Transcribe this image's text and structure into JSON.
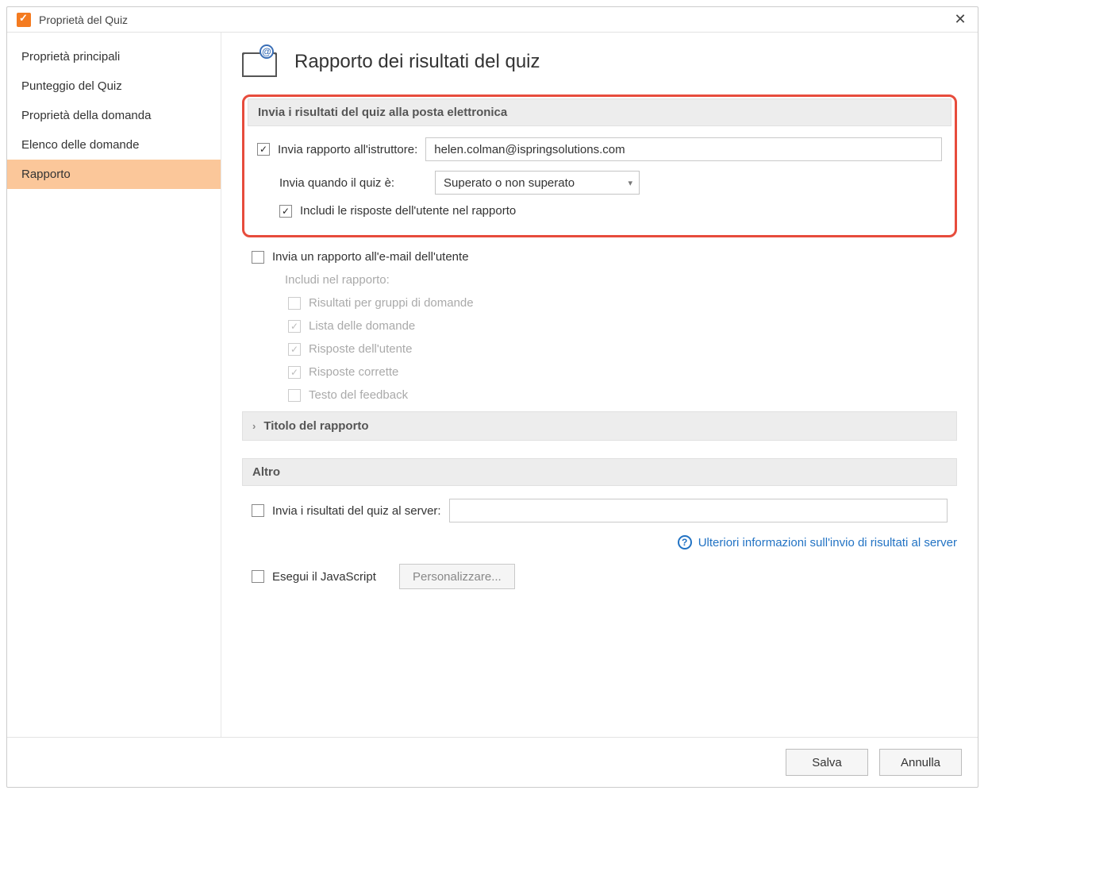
{
  "window": {
    "title": "Proprietà del Quiz"
  },
  "sidebar": {
    "items": [
      "Proprietà principali",
      "Punteggio del Quiz",
      "Proprietà della domanda",
      "Elenco delle domande",
      "Rapporto"
    ],
    "activeIndex": 4
  },
  "page": {
    "title": "Rapporto dei risultati del quiz",
    "email_section_title": "Invia i risultati del quiz alla posta elettronica",
    "send_instructor_label": "Invia rapporto all'istruttore:",
    "instructor_email": "helen.colman@ispringsolutions.com",
    "send_when_label": "Invia quando il quiz è:",
    "send_when_value": "Superato o non superato",
    "include_answers_label": "Includi le risposte dell'utente nel rapporto",
    "send_user_label": "Invia un rapporto all'e-mail dell'utente",
    "include_in_report_label": "Includi nel rapporto:",
    "sub_items": [
      "Risultati per gruppi di domande",
      "Lista delle domande",
      "Risposte dell'utente",
      "Risposte corrette",
      "Testo del feedback"
    ],
    "report_title_header": "Titolo del rapporto",
    "other_section_title": "Altro",
    "send_server_label": "Invia i risultati del quiz al server:",
    "server_value": "",
    "more_info_link": "Ulteriori informazioni sull'invio di risultati al server",
    "exec_js_label": "Esegui il JavaScript",
    "customize_btn": "Personalizzare..."
  },
  "footer": {
    "save": "Salva",
    "cancel": "Annulla"
  }
}
